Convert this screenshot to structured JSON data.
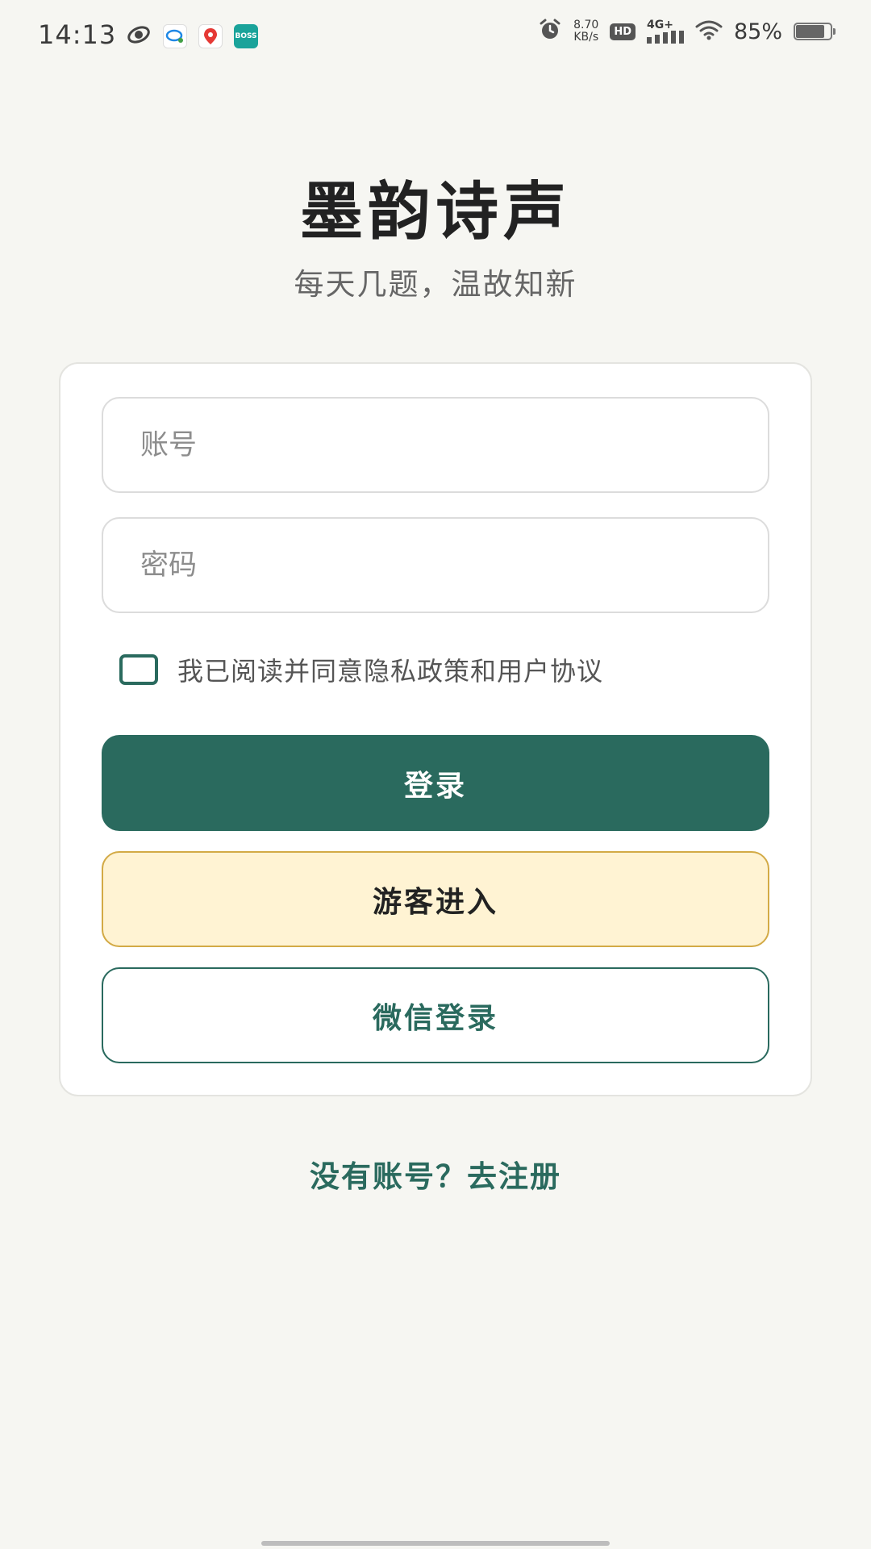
{
  "status_bar": {
    "time": "14:13",
    "net_speed_value": "8.70",
    "net_speed_unit": "KB/s",
    "hd_label": "HD",
    "network_label": "4G+",
    "battery_percent_text": "85%",
    "battery_level": 0.85,
    "icons": [
      "orbit-app-icon",
      "chat-app-icon",
      "map-pin-app-icon",
      "boss-app-icon",
      "alarm-icon",
      "signal-icon",
      "wifi-icon",
      "battery-icon"
    ],
    "boss_app_text": "BOSS"
  },
  "header": {
    "title": "墨韵诗声",
    "subtitle": "每天几题，温故知新"
  },
  "form": {
    "account_placeholder": "账号",
    "password_placeholder": "密码",
    "agreement_text": "我已阅读并同意隐私政策和用户协议"
  },
  "buttons": {
    "login_label": "登录",
    "guest_label": "游客进入",
    "wechat_label": "微信登录"
  },
  "footer": {
    "register_link": "没有账号？去注册"
  },
  "colors": {
    "primary": "#2a6a5e",
    "guest_bg": "#fff3d3",
    "guest_border": "#d3aa46",
    "page_bg": "#f6f6f2"
  }
}
